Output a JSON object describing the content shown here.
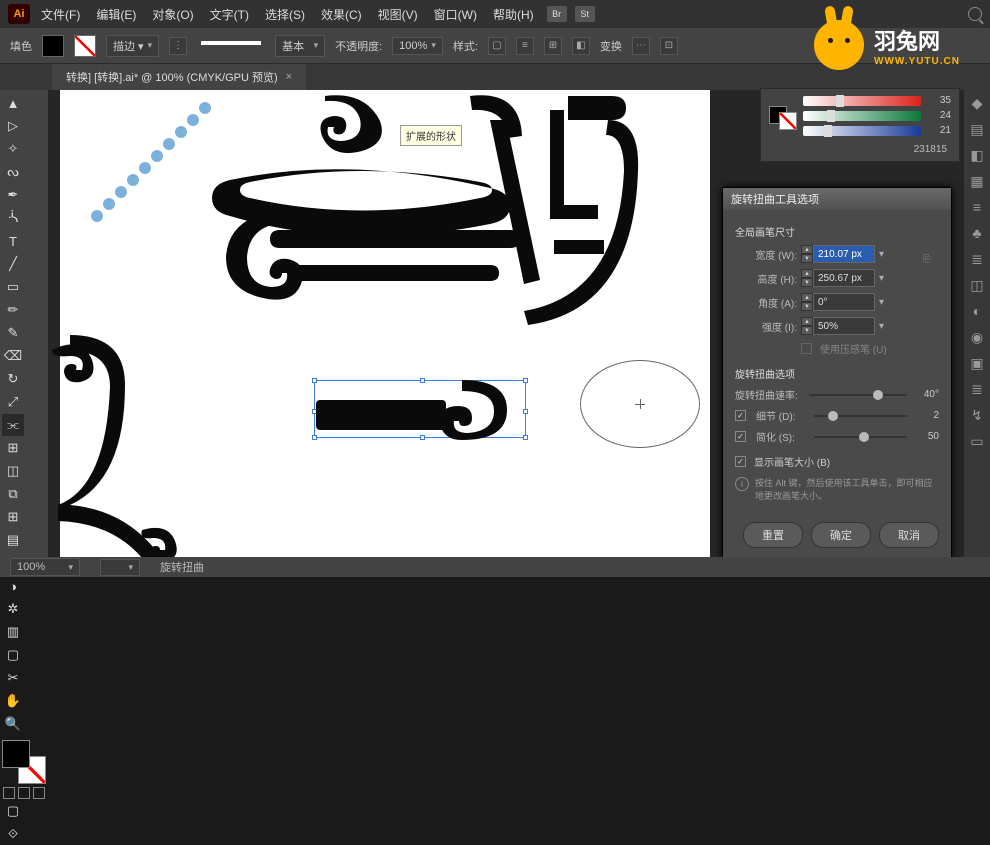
{
  "menu": {
    "file": "文件(F)",
    "edit": "编辑(E)",
    "object": "对象(O)",
    "type": "文字(T)",
    "select": "选择(S)",
    "effect": "效果(C)",
    "view": "视图(V)",
    "window": "窗口(W)",
    "help": "帮助(H)"
  },
  "top_badges": {
    "br": "Br",
    "st": "St"
  },
  "control": {
    "fill_lbl": "填色",
    "stroke_lbl": "描边 ▾",
    "basic": "基本",
    "opacity_lbl": "不透明度:",
    "opacity": "100%",
    "style_lbl": "样式:",
    "transform": "变换"
  },
  "doc_tab": {
    "title": "转换] [转换].ai* @ 100% (CMYK/GPU 预览)",
    "close": "×"
  },
  "tooltip": {
    "expand": "扩展的形状"
  },
  "color_panel": {
    "c": "35",
    "m": "24",
    "y": "21",
    "hex": "231815"
  },
  "dialog": {
    "title": "旋转扭曲工具选项",
    "sec_brush": "全局画笔尺寸",
    "width_lbl": "宽度 (W):",
    "width_val": "210.07 px",
    "height_lbl": "高度 (H):",
    "height_val": "250.67 px",
    "angle_lbl": "角度 (A):",
    "angle_val": "0°",
    "intensity_lbl": "强度 (I):",
    "intensity_val": "50%",
    "pressure_lbl": "使用压感笔 (U)",
    "sec_twirl": "旋转扭曲选项",
    "rate_lbl": "旋转扭曲速率:",
    "rate_val": "40°",
    "detail_lbl": "细节 (D):",
    "detail_val": "2",
    "simplify_lbl": "简化 (S):",
    "simplify_val": "50",
    "showsize_lbl": "显示画笔大小 (B)",
    "hint": "按住 Alt 键，然后使用该工具单击，即可相应地更改画笔大小。",
    "btn_reset": "重置",
    "btn_ok": "确定",
    "btn_cancel": "取消"
  },
  "status": {
    "zoom": "100%",
    "label": "旋转扭曲"
  },
  "brand": {
    "name": "羽兔网",
    "url": "WWW.YUTU.CN"
  }
}
